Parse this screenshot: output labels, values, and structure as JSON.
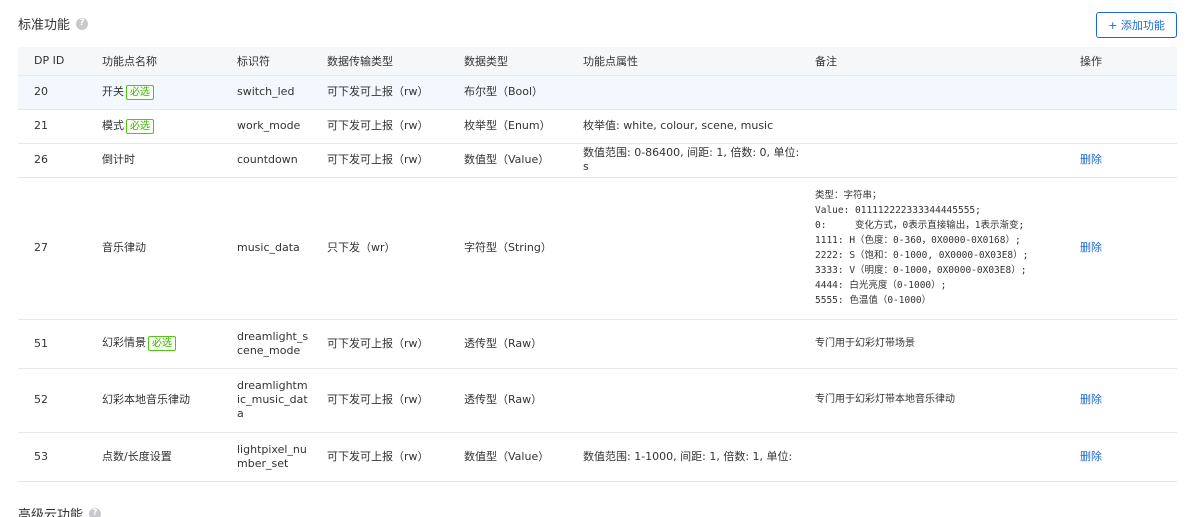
{
  "standard_section": {
    "title": "标准功能",
    "add_button": "+ 添加功能"
  },
  "table": {
    "headers": [
      "DP ID",
      "功能点名称",
      "标识符",
      "数据传输类型",
      "数据类型",
      "功能点属性",
      "备注",
      "操作"
    ],
    "rows": [
      {
        "id": "20",
        "name": "开关",
        "required": "必选",
        "identifier": "switch_led",
        "transfer": "可下发可上报（rw）",
        "dtype": "布尔型（Bool）",
        "props": "",
        "notes": "",
        "action": ""
      },
      {
        "id": "21",
        "name": "模式",
        "required": "必选",
        "identifier": "work_mode",
        "transfer": "可下发可上报（rw）",
        "dtype": "枚举型（Enum）",
        "props": "枚举值: white, colour, scene, music",
        "notes": "",
        "action": ""
      },
      {
        "id": "26",
        "name": "倒计时",
        "required": "",
        "identifier": "countdown",
        "transfer": "可下发可上报（rw）",
        "dtype": "数值型（Value）",
        "props": "数值范围: 0-86400, 间距: 1, 倍数: 0, 单位: s",
        "notes": "",
        "action": "删除"
      },
      {
        "id": "27",
        "name": "音乐律动",
        "required": "",
        "identifier": "music_data",
        "transfer": "只下发（wr）",
        "dtype": "字符型（String）",
        "props": "",
        "notes": "类型：字符串；\nValue: 011112222333344445555;\n0:     变化方式，0表示直接输出，1表示渐变;\n1111: H（色度：0-360，0X0000-0X0168）;\n2222: S（饱和：0-1000, 0X0000-0X03E8）;\n3333: V（明度：0-1000，0X0000-0X03E8）;\n4444: 白光亮度（0-1000）;\n5555: 色温值（0-1000）",
        "action": "删除"
      },
      {
        "id": "51",
        "name": "幻彩情景",
        "required": "必选",
        "identifier": "dreamlight_s\ncene_mode",
        "transfer": "可下发可上报（rw）",
        "dtype": "透传型（Raw）",
        "props": "",
        "notes": "专门用于幻彩灯带场景",
        "action": ""
      },
      {
        "id": "52",
        "name": "幻彩本地音乐律动",
        "required": "",
        "identifier": "dreamlightm\nic_music_dat\na",
        "transfer": "可下发可上报（rw）",
        "dtype": "透传型（Raw）",
        "props": "",
        "notes": "专门用于幻彩灯带本地音乐律动",
        "action": "删除"
      },
      {
        "id": "53",
        "name": "点数/长度设置",
        "required": "",
        "identifier": "lightpixel_nu\nmber_set",
        "transfer": "可下发可上报（rw）",
        "dtype": "数值型（Value）",
        "props": "数值范围: 1-1000, 间距: 1, 倍数: 1, 单位:",
        "notes": "",
        "action": "删除"
      }
    ]
  },
  "advanced_section": {
    "title": "高级云功能"
  },
  "icons": {
    "help": "question-circle-icon"
  },
  "colors": {
    "accent": "#1a6ad4",
    "required_badge": "#52c41a",
    "header_bg": "#f6f7f9",
    "highlight_row": "#f2f8fd"
  }
}
